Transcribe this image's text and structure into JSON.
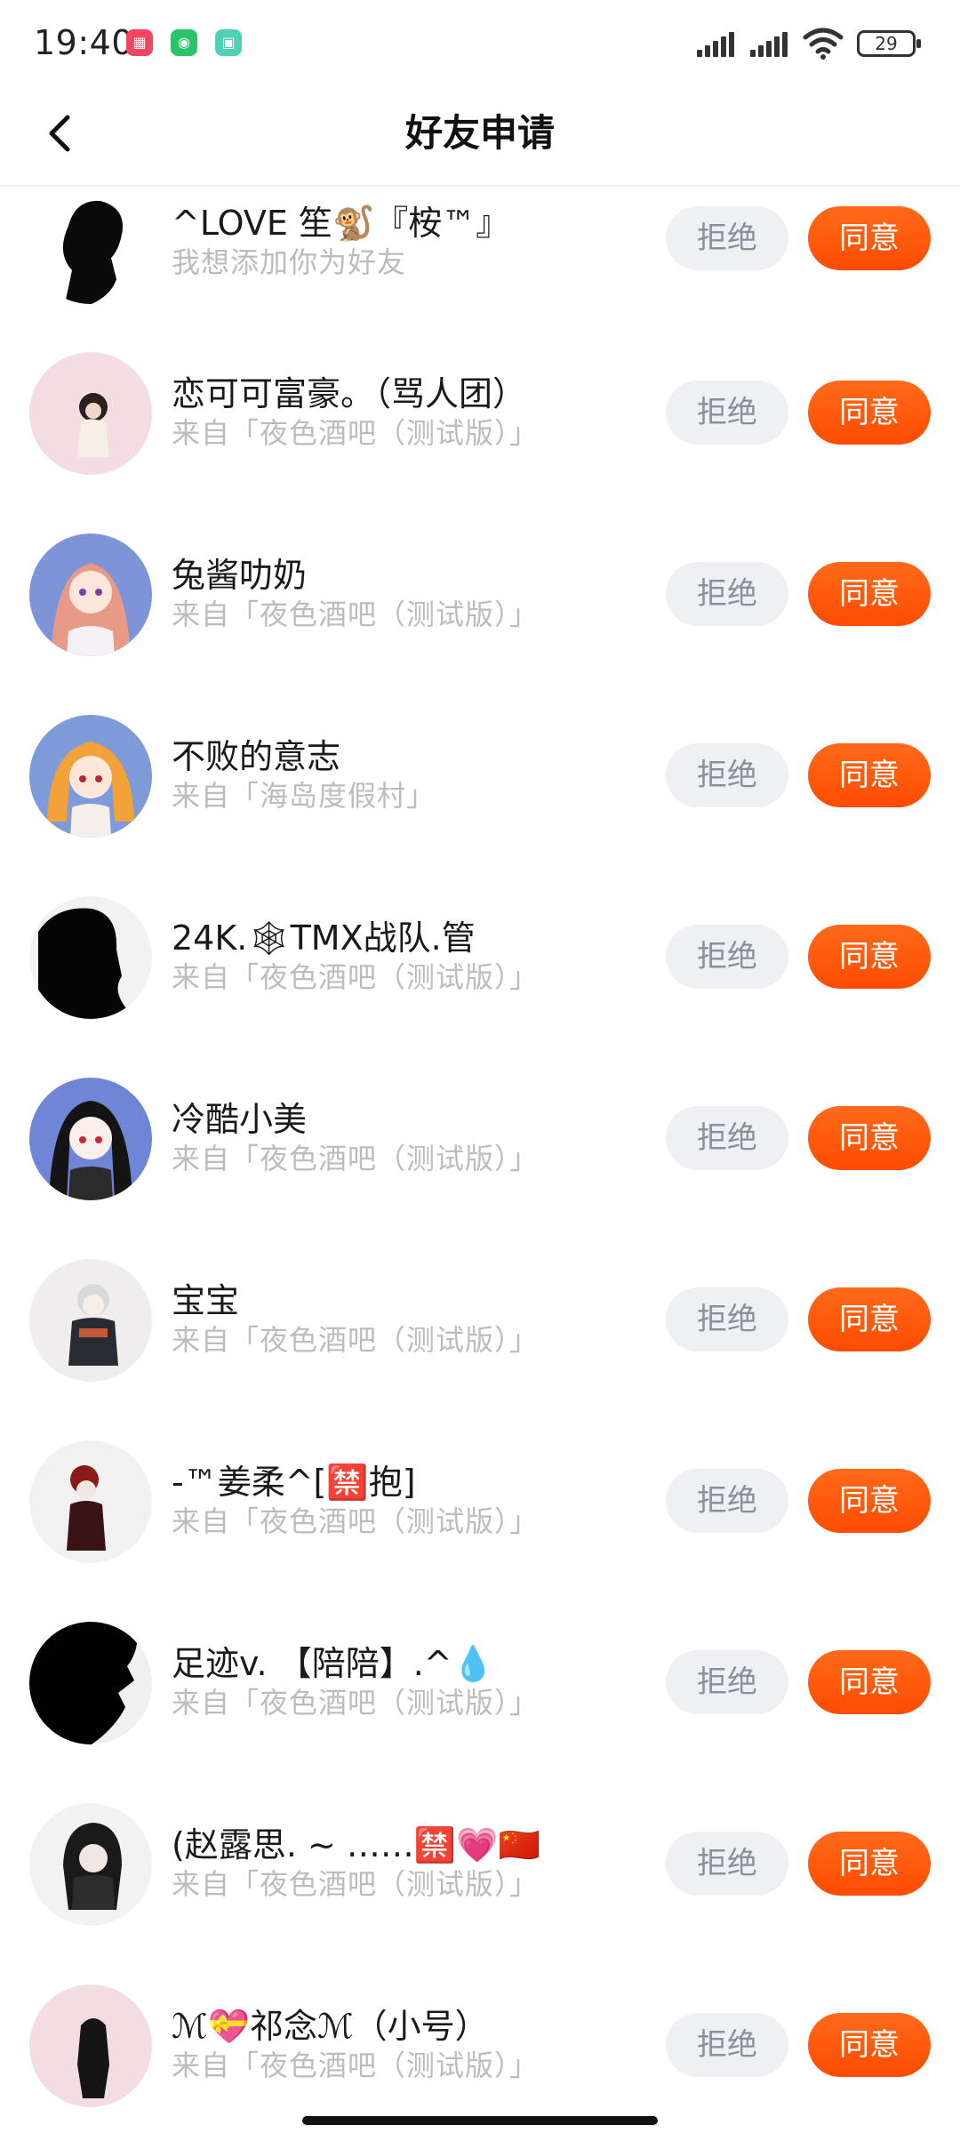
{
  "status_bar": {
    "time": "19:40",
    "battery": "29"
  },
  "nav": {
    "title": "好友申请",
    "back_icon": "chevron-left-icon"
  },
  "buttons": {
    "reject": "拒绝",
    "accept": "同意"
  },
  "colors": {
    "accept": "#ff5a0a",
    "reject_bg": "#eef0f4",
    "subtext": "#bcbcbc"
  },
  "requests": [
    {
      "name": "^LOVE 笙🐒『桉™』",
      "source": "我想添加你为好友"
    },
    {
      "name": "恋可可富豪。（骂人团）",
      "source": "来自「夜色酒吧（测试版）」"
    },
    {
      "name": "兔酱叻奶",
      "source": "来自「夜色酒吧（测试版）」"
    },
    {
      "name": "不败的意志",
      "source": "来自「海岛度假村」"
    },
    {
      "name": "24K.🕸TMX战队.管",
      "source": "来自「夜色酒吧（测试版）」"
    },
    {
      "name": "冷酷小美",
      "source": "来自「夜色酒吧（测试版）」"
    },
    {
      "name": "宝宝",
      "source": "来自「夜色酒吧（测试版）」"
    },
    {
      "name": "-™姜柔^[🈲抱]",
      "source": "来自「夜色酒吧（测试版）」"
    },
    {
      "name": "足迹v. 【陪陪】.^💧",
      "source": "来自「夜色酒吧（测试版）」"
    },
    {
      "name": "(赵露思. ~ ……🈲💗🇨🇳",
      "source": "来自「夜色酒吧（测试版）」"
    },
    {
      "name": "ℳ💝祁念ℳ（小号）",
      "source": "来自「夜色酒吧（测试版）」"
    }
  ]
}
